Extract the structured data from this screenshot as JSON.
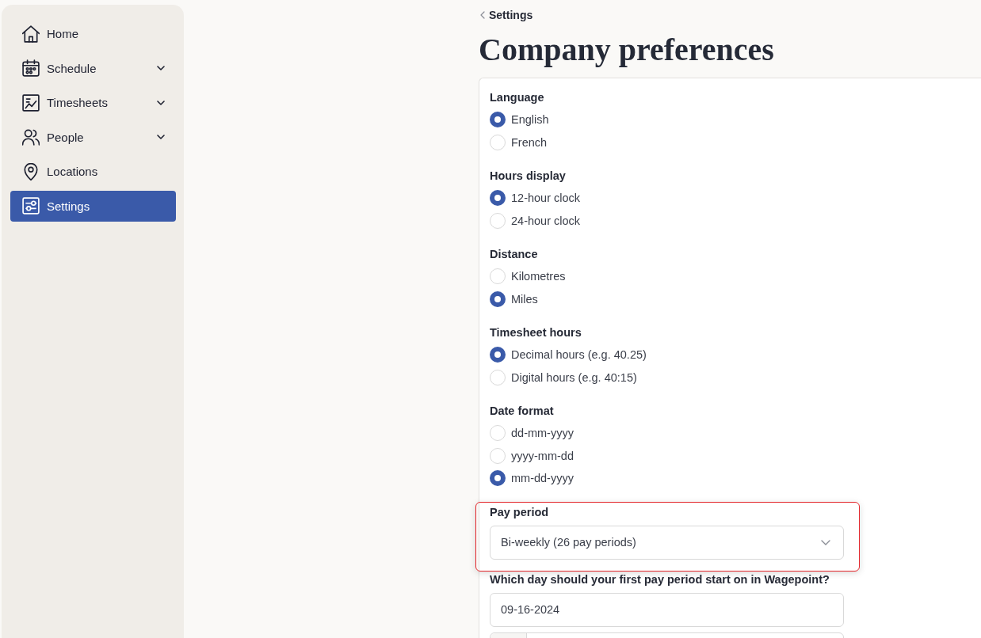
{
  "sidebar": {
    "items": [
      {
        "label": "Home",
        "expandable": false,
        "selected": false
      },
      {
        "label": "Schedule",
        "expandable": true,
        "selected": false
      },
      {
        "label": "Timesheets",
        "expandable": true,
        "selected": false
      },
      {
        "label": "People",
        "expandable": true,
        "selected": false
      },
      {
        "label": "Locations",
        "expandable": false,
        "selected": false
      },
      {
        "label": "Settings",
        "expandable": false,
        "selected": true
      }
    ]
  },
  "breadcrumb": {
    "label": "Settings"
  },
  "page_title": "Company preferences",
  "sections": [
    {
      "kind": "radio",
      "label": "Language",
      "options": [
        {
          "label": "English",
          "selected": true
        },
        {
          "label": "French",
          "selected": false
        }
      ]
    },
    {
      "kind": "radio",
      "label": "Hours display",
      "options": [
        {
          "label": "12-hour clock",
          "selected": true
        },
        {
          "label": "24-hour clock",
          "selected": false
        }
      ]
    },
    {
      "kind": "radio",
      "label": "Distance",
      "options": [
        {
          "label": "Kilometres",
          "selected": false
        },
        {
          "label": "Miles",
          "selected": true
        }
      ]
    },
    {
      "kind": "radio",
      "label": "Timesheet hours",
      "options": [
        {
          "label": "Decimal hours (e.g. 40.25)",
          "selected": true
        },
        {
          "label": "Digital hours (e.g. 40:15)",
          "selected": false
        }
      ]
    },
    {
      "kind": "radio",
      "label": "Date format",
      "options": [
        {
          "label": "dd-mm-yyyy",
          "selected": false
        },
        {
          "label": "yyyy-mm-dd",
          "selected": false
        },
        {
          "label": "mm-dd-yyyy",
          "selected": true
        }
      ]
    },
    {
      "kind": "select",
      "label": "Pay period",
      "value": "Bi-weekly (26 pay periods)",
      "highlighted": true
    },
    {
      "kind": "input",
      "label": "Which day should your first pay period start on in Wagepoint?",
      "value": "09-16-2024"
    },
    {
      "kind": "split-field"
    }
  ]
}
